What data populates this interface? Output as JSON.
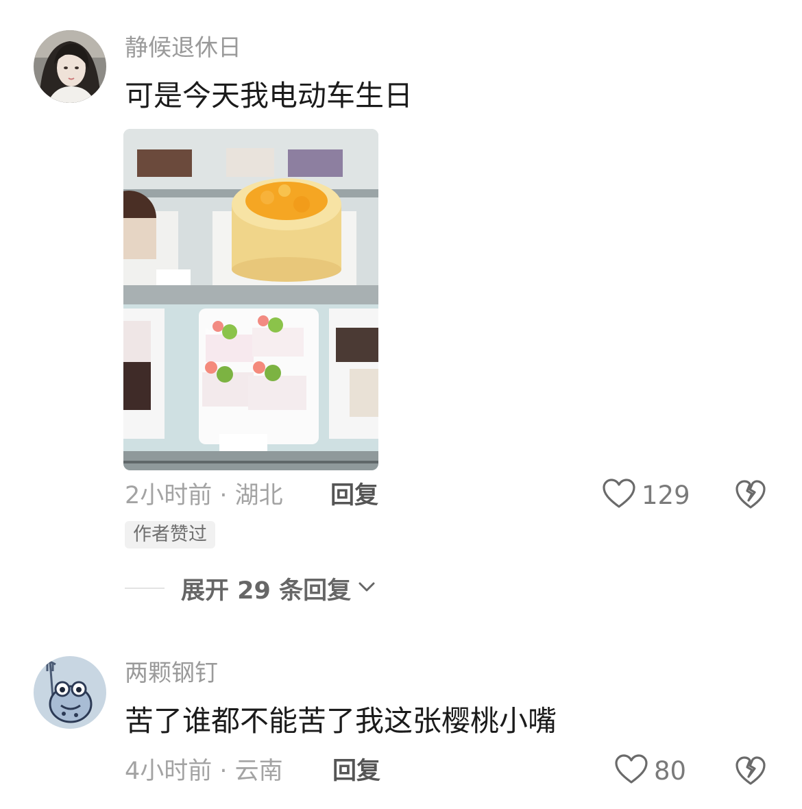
{
  "comments": [
    {
      "username": "静候退休日",
      "text": "可是今天我电动车生日",
      "time_location": "2小时前 · 湖北",
      "reply_label": "回复",
      "likes": "129",
      "badge": "作者赞过",
      "expand_label": "展开 29 条回复"
    },
    {
      "username": "两颗钢钉",
      "text": "苦了谁都不能苦了我这张樱桃小嘴",
      "time_location": "4小时前 · 云南",
      "reply_label": "回复",
      "likes": "80"
    }
  ],
  "colors": {
    "username": "#9a9a9a",
    "text": "#1b1b1b",
    "meta": "#a3a3a3",
    "icon": "#6a6a6a"
  }
}
